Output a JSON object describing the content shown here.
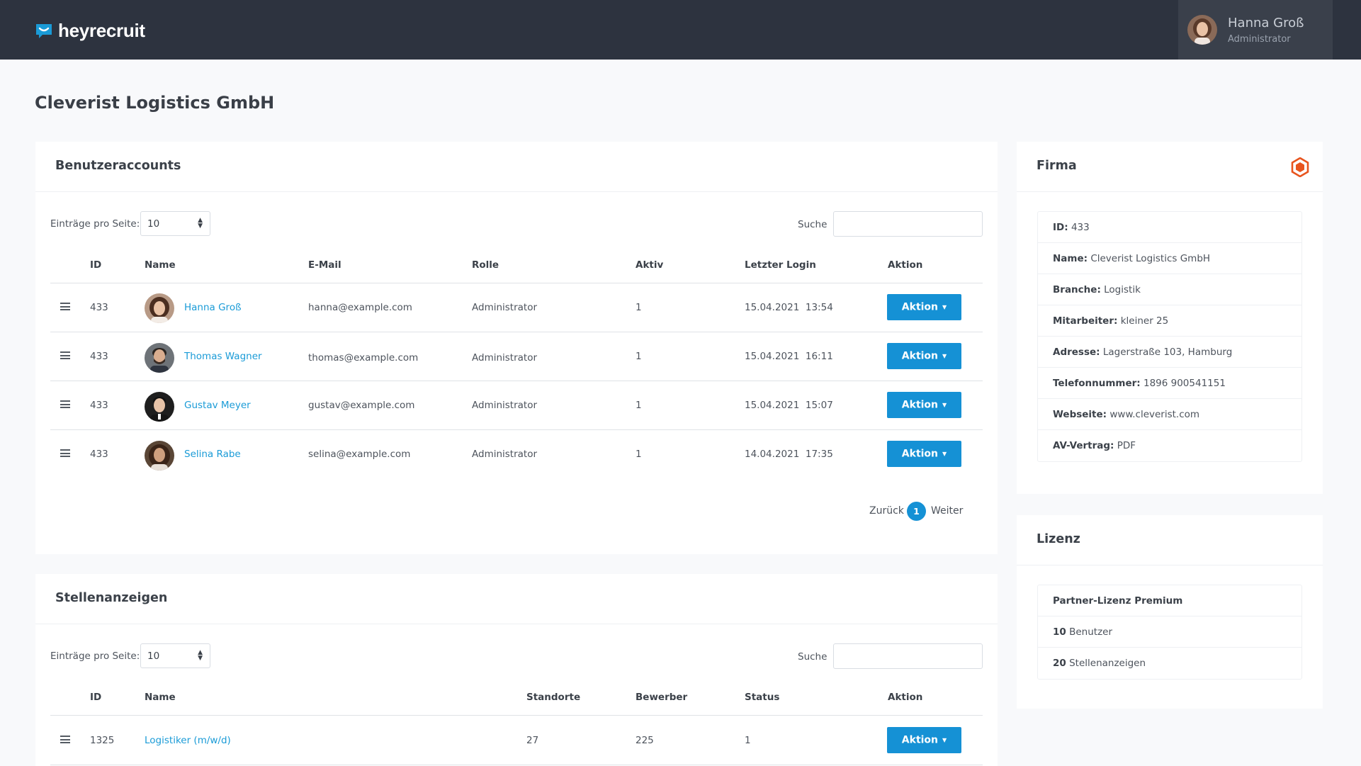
{
  "brand": {
    "name": "heyrecruit"
  },
  "user": {
    "name": "Hanna Groß",
    "role": "Administrator"
  },
  "page_title": "Cleverist Logistics GmbH",
  "accounts": {
    "title": "Benutzeraccounts",
    "entries_label": "Einträge pro Seite:",
    "entries_value": "10",
    "search_label": "Suche",
    "search_value": "",
    "columns": [
      "ID",
      "Name",
      "E-Mail",
      "Rolle",
      "Aktiv",
      "Letzter Login",
      "Aktion"
    ],
    "rows": [
      {
        "id": "433",
        "name": "Hanna Groß",
        "email": "hanna@example.com",
        "role": "Administrator",
        "active": "1",
        "last_login": "15.04.2021  13:54",
        "action": "Aktion"
      },
      {
        "id": "433",
        "name": "Thomas Wagner",
        "email": "thomas@example.com",
        "role": "Administrator",
        "active": "1",
        "last_login": "15.04.2021  16:11",
        "action": "Aktion"
      },
      {
        "id": "433",
        "name": "Gustav Meyer",
        "email": "gustav@example.com",
        "role": "Administrator",
        "active": "1",
        "last_login": "15.04.2021  15:07",
        "action": "Aktion"
      },
      {
        "id": "433",
        "name": "Selina Rabe",
        "email": "selina@example.com",
        "role": "Administrator",
        "active": "1",
        "last_login": "14.04.2021  17:35",
        "action": "Aktion"
      }
    ],
    "pagination": {
      "prev": "Zurück",
      "current": "1",
      "next": "Weiter"
    }
  },
  "jobs": {
    "title": "Stellenanzeigen",
    "entries_label": "Einträge pro Seite:",
    "entries_value": "10",
    "search_label": "Suche",
    "search_value": "",
    "columns": [
      "ID",
      "Name",
      "Standorte",
      "Bewerber",
      "Status",
      "Aktion"
    ],
    "rows": [
      {
        "id": "1325",
        "name": "Logistiker (m/w/d)",
        "locations": "27",
        "applicants": "225",
        "status": "1",
        "action": "Aktion"
      }
    ]
  },
  "company": {
    "title": "Firma",
    "fields": [
      {
        "label": "ID:",
        "value": "433"
      },
      {
        "label": "Name:",
        "value": "Cleverist Logistics GmbH"
      },
      {
        "label": "Branche:",
        "value": "Logistik"
      },
      {
        "label": "Mitarbeiter:",
        "value": "kleiner 25"
      },
      {
        "label": "Adresse:",
        "value": "Lagerstraße 103, Hamburg"
      },
      {
        "label": "Telefonnummer:",
        "value": "1896 900541151"
      },
      {
        "label": "Webseite:",
        "value": "www.cleverist.com"
      },
      {
        "label": "AV-Vertrag:",
        "value": "PDF"
      }
    ]
  },
  "license": {
    "title": "Lizenz",
    "plan": "Partner-Lizenz Premium",
    "users_count": "10",
    "users_label": "Benutzer",
    "jobs_count": "20",
    "jobs_label": "Stellenanzeigen"
  },
  "colors": {
    "topbar": "#2d333f",
    "accent": "#1591d5",
    "link": "#1a9bd7",
    "brand_icon": "#1a9bd7",
    "company_icon": "#e8541e"
  },
  "icons": {
    "logo": "chat-bubble-icon",
    "menu": "hamburger-icon",
    "company": "hexagon-logo-icon",
    "dropdown": "caret-down-icon",
    "select": "updown-arrows-icon"
  }
}
